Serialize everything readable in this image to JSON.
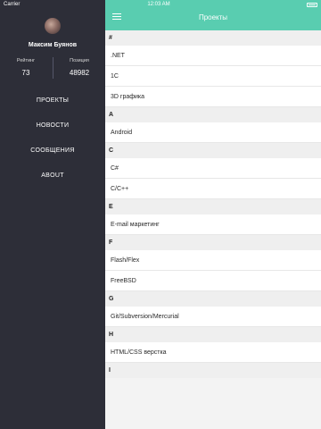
{
  "status": {
    "carrier": "Carrier",
    "time": "12:03 AM"
  },
  "header": {
    "title": "Проекты"
  },
  "user": {
    "name": "Максим Буянов",
    "rating_label": "Рейтинг",
    "rating_value": "73",
    "position_label": "Позиция",
    "position_value": "48982"
  },
  "menu": [
    {
      "label": "ПРОЕКТЫ"
    },
    {
      "label": "НОВОСТИ"
    },
    {
      "label": "СООБЩЕНИЯ"
    },
    {
      "label": "ABOUT"
    }
  ],
  "list": {
    "sections": [
      {
        "title": "#",
        "items": [
          ".NET",
          "1C",
          "3D графика"
        ]
      },
      {
        "title": "A",
        "items": [
          "Android"
        ]
      },
      {
        "title": "C",
        "items": [
          "C#",
          "C/C++"
        ]
      },
      {
        "title": "E",
        "items": [
          "E-mail маркетинг"
        ]
      },
      {
        "title": "F",
        "items": [
          "Flash/Flex",
          "FreeBSD"
        ]
      },
      {
        "title": "G",
        "items": [
          "Git/Subversion/Mercurial"
        ]
      },
      {
        "title": "H",
        "items": [
          "HTML/CSS верстка"
        ]
      },
      {
        "title": "I",
        "items": []
      }
    ]
  }
}
